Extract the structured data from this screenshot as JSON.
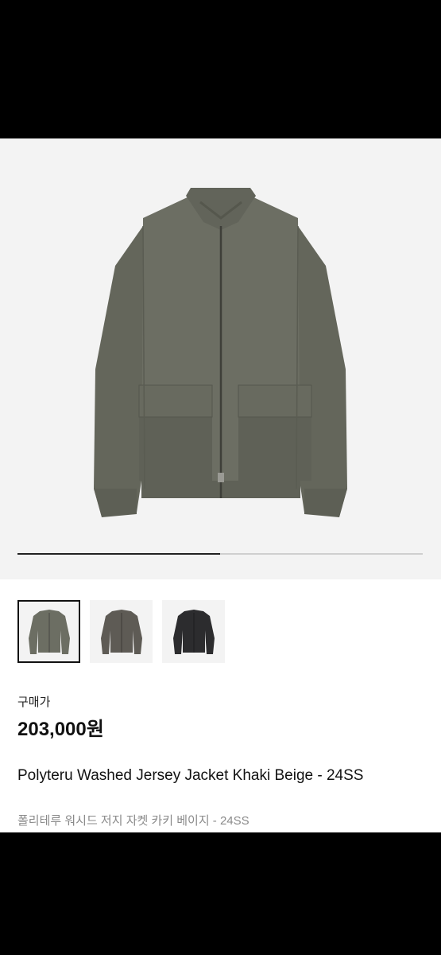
{
  "product": {
    "price_label": "구매가",
    "price": "203,000원",
    "title": "Polyteru Washed Jersey Jacket Khaki Beige - 24SS",
    "subtitle": "폴리테루 워시드 저지 자켓 카키 베이지 - 24SS",
    "image_progress": 0.5
  },
  "thumbnails": [
    {
      "color": "#6c6e63",
      "selected": true,
      "icon": "jacket-khaki-thumbnail"
    },
    {
      "color": "#5e5b55",
      "selected": false,
      "icon": "jacket-charcoal-thumbnail"
    },
    {
      "color": "#2c2c2e",
      "selected": false,
      "icon": "jacket-black-thumbnail"
    }
  ],
  "colors": {
    "jacket_main": "#6c6e63",
    "jacket_shadow": "#5a5c52",
    "jacket_rib": "#62645a"
  }
}
